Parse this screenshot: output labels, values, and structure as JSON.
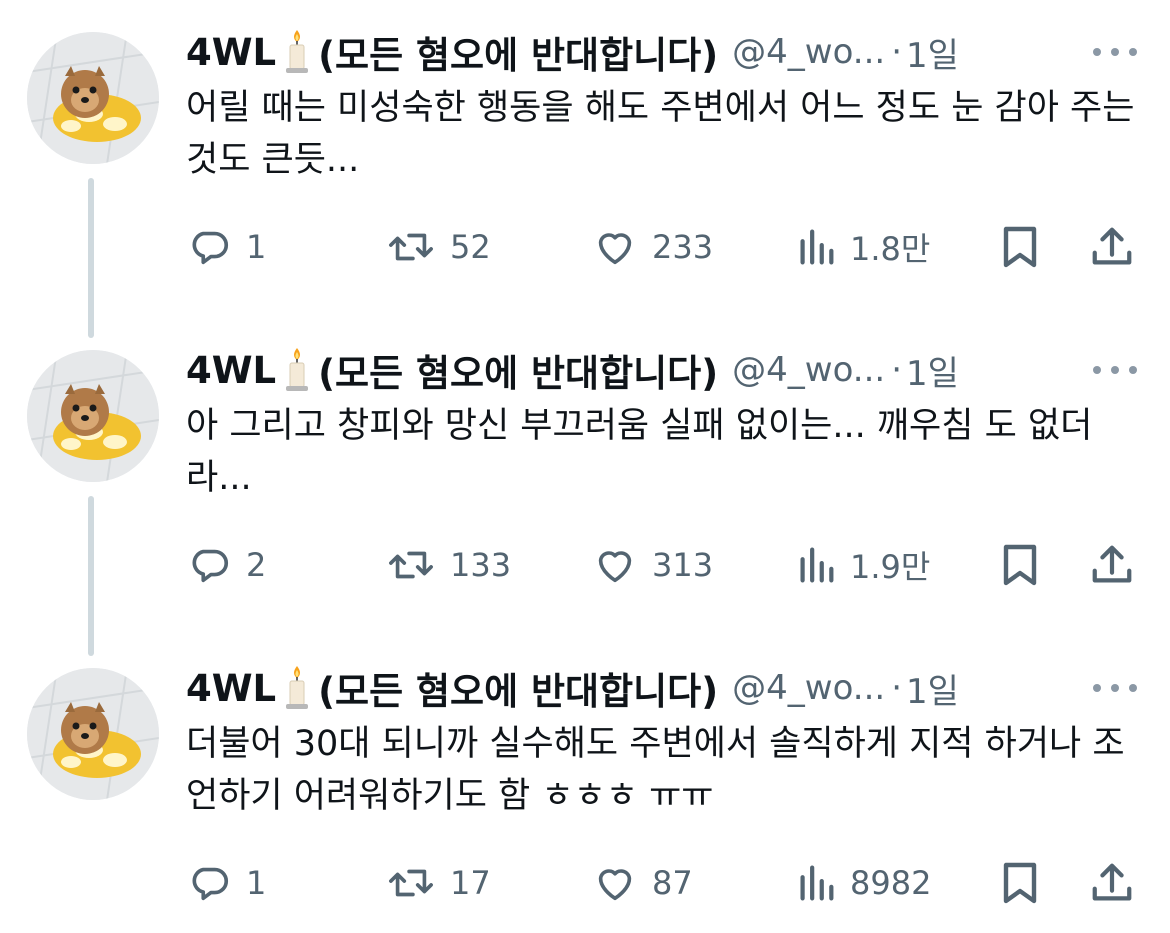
{
  "author": {
    "display_name": "4WL",
    "name_suffix": "(모든 혐오에 반대합니다)",
    "emoji_icon": "candle-icon",
    "handle": "@4_wo...",
    "separator": "·"
  },
  "colors": {
    "text": "#0f1419",
    "muted": "#536471",
    "thread_line": "#cfd9de"
  },
  "tweets": [
    {
      "time": "1일",
      "text": "어릴 때는 미성숙한 행동을 해도 주변에서 어느 정도 눈 감아 주는 것도 큰듯...",
      "replies": "1",
      "retweets": "52",
      "likes": "233",
      "views": "1.8만"
    },
    {
      "time": "1일",
      "text": "아 그리고 창피와 망신 부끄러움 실패 없이는... 깨우침 도 없더라...",
      "replies": "2",
      "retweets": "133",
      "likes": "313",
      "views": "1.9만"
    },
    {
      "time": "1일",
      "text": "더불어 30대 되니까 실수해도 주변에서 솔직하게 지적 하거나 조언하기 어려워하기도 함 ㅎㅎㅎ ㅠㅠ",
      "replies": "1",
      "retweets": "17",
      "likes": "87",
      "views": "8982"
    }
  ]
}
